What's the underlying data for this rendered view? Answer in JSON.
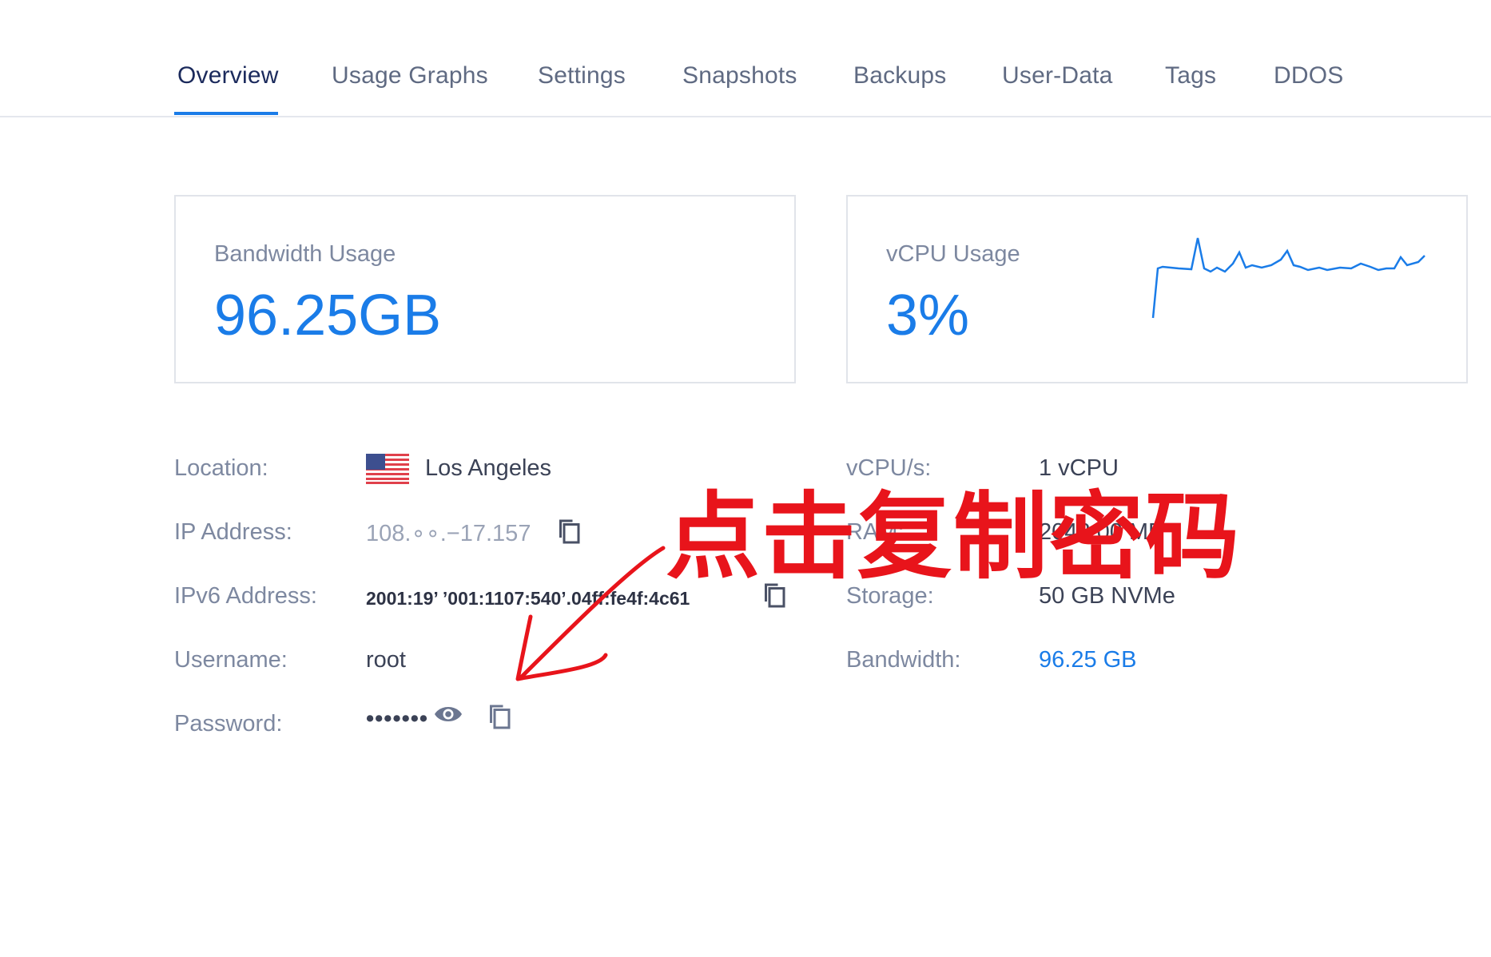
{
  "tabs": [
    {
      "label": "Overview",
      "active": true
    },
    {
      "label": "Usage Graphs"
    },
    {
      "label": "Settings"
    },
    {
      "label": "Snapshots"
    },
    {
      "label": "Backups"
    },
    {
      "label": "User-Data"
    },
    {
      "label": "Tags"
    },
    {
      "label": "DDOS"
    }
  ],
  "cards": {
    "bandwidth": {
      "label": "Bandwidth Usage",
      "value": "96.25GB"
    },
    "vcpu": {
      "label": "vCPU Usage",
      "value": "3%",
      "sparkline_icon": "cpu-usage-sparkline"
    }
  },
  "details_left": {
    "location": {
      "label": "Location:",
      "value": "Los Angeles",
      "flag_icon": "us-flag-icon"
    },
    "ip": {
      "label": "IP Address:",
      "value": "108.∘∘.−17.157"
    },
    "ipv6": {
      "label": "IPv6 Address:",
      "value": "2001:19’ ’001:1107:540’.04ff:fe4f:4c61"
    },
    "username": {
      "label": "Username:",
      "value": "root"
    },
    "password": {
      "label": "Password:",
      "value": "•••••••"
    }
  },
  "details_right": {
    "vcpus": {
      "label": "vCPU/s:",
      "value": "1 vCPU"
    },
    "ram": {
      "label": "RAM:",
      "value": "2048.00 MB"
    },
    "storage": {
      "label": "Storage:",
      "value": "50 GB NVMe"
    },
    "bandwidth": {
      "label": "Bandwidth:",
      "value": "96.25 GB"
    }
  },
  "annotation": {
    "text": "点击复制密码",
    "color": "#e8141b"
  },
  "colors": {
    "accent": "#1a7ce8",
    "label": "#7d88a0",
    "text": "#3b4256"
  }
}
